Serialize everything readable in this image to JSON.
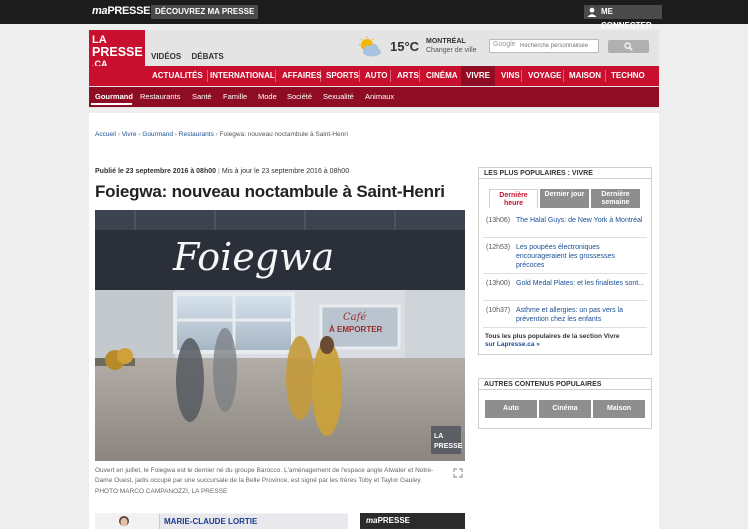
{
  "topbar": {
    "brand_prefix": "ma",
    "brand_name": "PRESSE",
    "discover_label": "DÉCOUVREZ MA PRESSE",
    "connect_label": "ME CONNECTER"
  },
  "header": {
    "logo_lines": [
      "LA",
      "PRESSE",
      ".CA"
    ],
    "top_links": [
      "VIDÉOS",
      "DÉBATS"
    ],
    "weather": {
      "temperature": "15°C",
      "city": "MONTRÉAL",
      "change_city": "Changer de ville"
    },
    "search": {
      "engine_label": "Google",
      "placeholder": "Recherche personnalisée"
    }
  },
  "main_nav": [
    "ACTUALITÉS",
    "INTERNATIONAL",
    "AFFAIRES",
    "SPORTS",
    "AUTO",
    "ARTS",
    "CINÉMA",
    "VIVRE",
    "VINS",
    "VOYAGE",
    "MAISON",
    "TECHNO"
  ],
  "main_nav_active": "VIVRE",
  "sub_nav": [
    "Gourmand",
    "Restaurants",
    "Santé",
    "Famille",
    "Mode",
    "Société",
    "Sexualité",
    "Animaux"
  ],
  "sub_nav_active": "Gourmand",
  "breadcrumb": [
    "Accueil",
    "Vivre",
    "Gourmand",
    "Restaurants",
    "Foiegwa: nouveau noctambule à Saint-Henri"
  ],
  "article": {
    "published": "Publié le 23 septembre 2016 à 08h00",
    "updated": "Mis à jour le 23 septembre 2016 à 08h00",
    "title": "Foiegwa: nouveau noctambule à Saint-Henri",
    "photo": {
      "sign_text": "Foiegwa",
      "window_text": "À EMPORTER",
      "window_script": "Café",
      "watermark": [
        "LA",
        "PRESSE"
      ]
    },
    "caption": "Ouvert en juillet, le Foiegwa est le dernier né du groupe Barocco. L'aménagement de l'espace angle Atwater et Notre-Dame Ouest, jadis occupé par une succursale de la Belle Province, est signé par les frères Toby et Taylor Gauley.",
    "credit": "PHOTO MARCO CAMPANOZZI, LA PRESSE",
    "author": "MARIE-CLAUDE LORTIE",
    "mapresse_label": "PRESSE"
  },
  "popular": {
    "heading": "LES PLUS POPULAIRES : VIVRE",
    "tabs": [
      "Dernière heure",
      "Dernier jour",
      "Dernière semaine"
    ],
    "active_tab": "Dernière heure",
    "items": [
      {
        "time": "(13h06)",
        "title": "The Halal Guys: de New York à Montréal"
      },
      {
        "time": "(12h53)",
        "title": "Les poupées électroniques encourageraient les grossesses précoces"
      },
      {
        "time": "(13h00)",
        "title": "Gold Medal Plates: et les finalistes sont..."
      },
      {
        "time": "(10h37)",
        "title": "Asthme et allergies: un pas vers la prévention chez les enfants"
      }
    ],
    "footer_line1": "Tous les plus populaires de la section Vivre",
    "footer_line2": "sur Lapresse.ca »"
  },
  "others": {
    "heading": "AUTRES CONTENUS POPULAIRES",
    "buttons": [
      "Auto",
      "Cinéma",
      "Maison"
    ]
  },
  "colors": {
    "brand_red": "#c8102e",
    "dark_red": "#8e0d24",
    "link_blue": "#1a4f94",
    "topbar": "#1c1c1c"
  }
}
